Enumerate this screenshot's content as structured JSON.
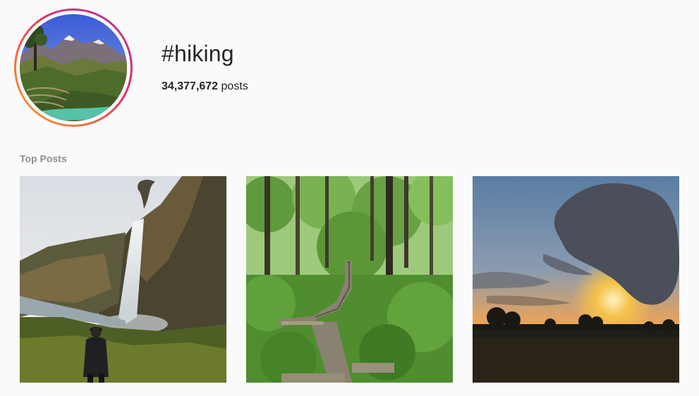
{
  "hashtag": {
    "title": "#hiking",
    "post_count": "34,377,672",
    "post_count_suffix": "posts"
  },
  "section": {
    "label": "Top Posts"
  },
  "posts": [
    {
      "scene": "waterfall-cliff-hiker"
    },
    {
      "scene": "forest-boardwalk"
    },
    {
      "scene": "sunset-field"
    }
  ],
  "colors": {
    "background": "#fafafa",
    "text": "#262626",
    "secondary_text": "#8e8e8e",
    "ring_start": "#f9a83c",
    "ring_end": "#bc2a8d"
  }
}
